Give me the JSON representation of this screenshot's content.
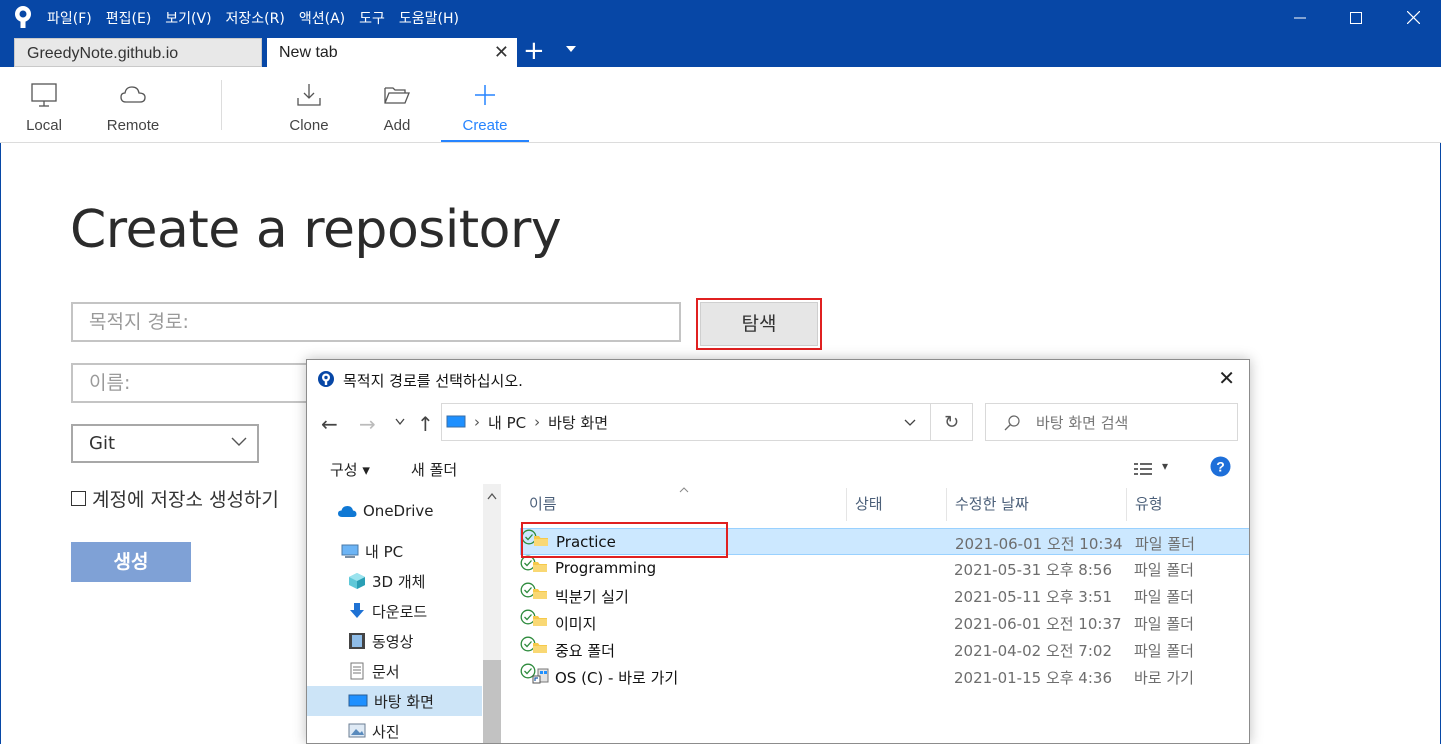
{
  "menu": [
    "파일(F)",
    "편집(E)",
    "보기(V)",
    "저장소(R)",
    "액션(A)",
    "도구",
    "도움말(H)"
  ],
  "tabs": {
    "inactive": "GreedyNote.github.io",
    "active": "New tab"
  },
  "toolbar": {
    "local": "Local",
    "remote": "Remote",
    "clone": "Clone",
    "add": "Add",
    "create": "Create"
  },
  "page": {
    "title": "Create a repository",
    "dest_placeholder": "목적지 경로:",
    "browse": "탐색",
    "name_placeholder": "이름:",
    "vcs": "Git",
    "account_checkbox": "계정에 저장소 생성하기",
    "create": "생성"
  },
  "dialog": {
    "title": "목적지 경로를 선택하십시오.",
    "breadcrumb": [
      "내 PC",
      "바탕 화면"
    ],
    "search_placeholder": "바탕 화면 검색",
    "organize": "구성",
    "new_folder": "새 폴더",
    "nav": [
      "OneDrive",
      "내 PC",
      "3D 개체",
      "다운로드",
      "동영상",
      "문서",
      "바탕 화면",
      "사진"
    ],
    "columns": [
      "이름",
      "상태",
      "수정한 날짜",
      "유형"
    ],
    "files": [
      {
        "name": "Practice",
        "date": "2021-06-01 오전 10:34",
        "type": "파일 폴더",
        "kind": "folder"
      },
      {
        "name": "Programming",
        "date": "2021-05-31 오후 8:56",
        "type": "파일 폴더",
        "kind": "folder"
      },
      {
        "name": "빅분기 실기",
        "date": "2021-05-11 오후 3:51",
        "type": "파일 폴더",
        "kind": "folder"
      },
      {
        "name": "이미지",
        "date": "2021-06-01 오전 10:37",
        "type": "파일 폴더",
        "kind": "folder"
      },
      {
        "name": "중요 폴더",
        "date": "2021-04-02 오전 7:02",
        "type": "파일 폴더",
        "kind": "folder"
      },
      {
        "name": "OS (C) - 바로 가기",
        "date": "2021-01-15 오후 4:36",
        "type": "바로 가기",
        "kind": "shortcut"
      }
    ]
  },
  "colors": {
    "titlebar": "#0747a6",
    "accent": "#2684ff",
    "highlight": "#e02020"
  }
}
